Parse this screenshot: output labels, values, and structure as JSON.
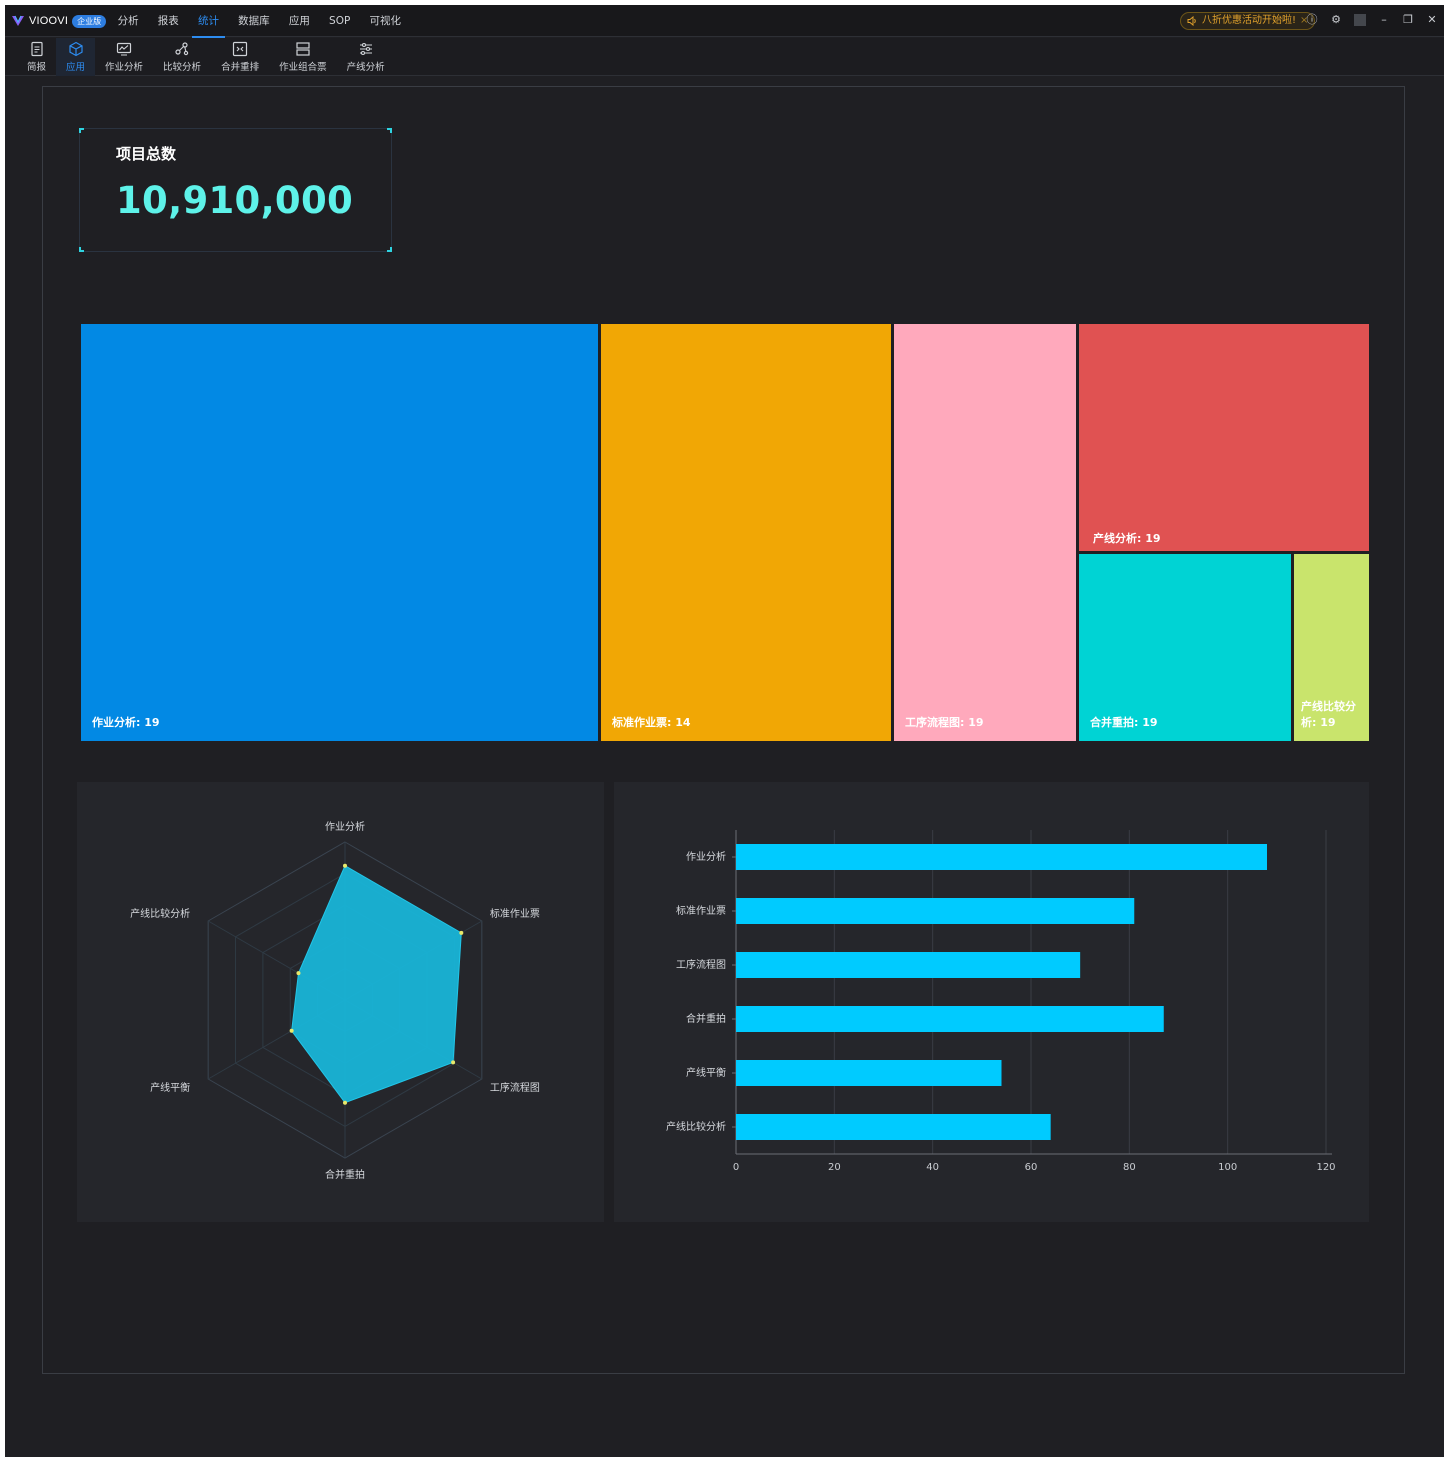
{
  "app": {
    "logo_text": "VIOOVI",
    "edition": "企业版",
    "menu": [
      {
        "label": "分析",
        "active": false
      },
      {
        "label": "报表",
        "active": false
      },
      {
        "label": "统计",
        "active": true
      },
      {
        "label": "数据库",
        "active": false
      },
      {
        "label": "应用",
        "active": false
      },
      {
        "label": "SOP",
        "active": false
      },
      {
        "label": "可视化",
        "active": false
      }
    ],
    "promo_text": "八折优惠活动开始啦!",
    "promo_close": "×",
    "window_icons": [
      "info-icon",
      "settings-icon",
      "minimize-icon",
      "restore-icon",
      "close-icon"
    ]
  },
  "toolbar": [
    {
      "label": "简报",
      "icon": "brief-icon",
      "active": false
    },
    {
      "label": "应用",
      "icon": "cube-icon",
      "active": true
    },
    {
      "label": "作业分析",
      "icon": "chart-monitor-icon",
      "active": false
    },
    {
      "label": "比较分析",
      "icon": "compare-nodes-icon",
      "active": false
    },
    {
      "label": "合并重排",
      "icon": "merge-icon",
      "active": false
    },
    {
      "label": "作业组合票",
      "icon": "stack-icon",
      "active": false
    },
    {
      "label": "产线分析",
      "icon": "sliders-icon",
      "active": false
    }
  ],
  "kpi": {
    "label": "项目总数",
    "value": "10,910,000"
  },
  "colors": {
    "accent": "#2d8cf0",
    "kpi_value": "#5ef2e9",
    "bar": "#00cbff",
    "radar_fill": "#18b8dc"
  },
  "chart_data": [
    {
      "type": "treemap",
      "items": [
        {
          "name": "作业分析",
          "value": 19,
          "label": "作业分析: 19",
          "color": "#0289e4"
        },
        {
          "name": "标准作业票",
          "value": 14,
          "label": "标准作业票: 14",
          "color": "#f1a705"
        },
        {
          "name": "工序流程图",
          "value": 19,
          "label": "工序流程图: 19",
          "color": "#ffa9bc"
        },
        {
          "name": "产线分析",
          "value": 19,
          "label": "产线分析: 19",
          "color": "#e05252"
        },
        {
          "name": "合并重拍",
          "value": 19,
          "label": "合并重拍: 19",
          "color": "#00d3d4"
        },
        {
          "name": "产线比较分析",
          "value": 19,
          "label": "产线比较分析: 19",
          "color": "#c9e46c"
        }
      ]
    },
    {
      "type": "radar",
      "indicators": [
        "作业分析",
        "标准作业票",
        "工序流程图",
        "合并重拍",
        "产线平衡",
        "产线比较分析"
      ],
      "values": [
        0.85,
        0.85,
        0.79,
        0.65,
        0.39,
        0.34
      ],
      "max": 1
    },
    {
      "type": "bar",
      "orientation": "horizontal",
      "categories": [
        "作业分析",
        "标准作业票",
        "工序流程图",
        "合并重拍",
        "产线平衡",
        "产线比较分析"
      ],
      "values": [
        108,
        81,
        70,
        87,
        54,
        64
      ],
      "xlim": [
        0,
        120
      ],
      "xticks": [
        "0",
        "20",
        "40",
        "60",
        "80",
        "100",
        "120"
      ]
    }
  ]
}
